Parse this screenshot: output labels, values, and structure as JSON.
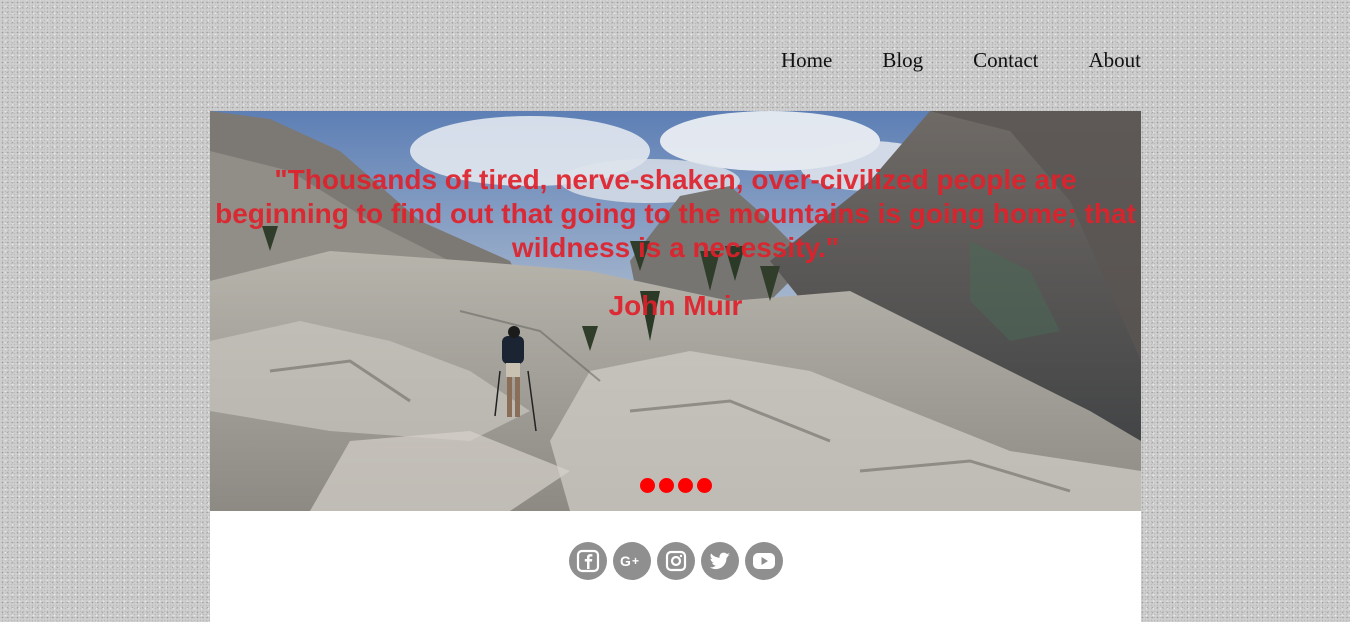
{
  "nav": {
    "items": [
      {
        "label": "Home"
      },
      {
        "label": "Blog"
      },
      {
        "label": "Contact"
      },
      {
        "label": "About"
      }
    ]
  },
  "hero": {
    "quote": "\"Thousands of tired, nerve-shaken, over-civilized people are beginning to find out that going to the mountains is going home; that wildness is a necessity.\"",
    "author": "John Muir",
    "image_description_icon": "mountain-hiker-photo",
    "slide_indicators": 4,
    "accent_color": "#ff0000",
    "quote_color": "#e0212b"
  },
  "social": {
    "icons": [
      "facebook-icon",
      "google-plus-icon",
      "instagram-icon",
      "twitter-icon",
      "youtube-icon"
    ],
    "icon_color": "#8f8f8f"
  }
}
